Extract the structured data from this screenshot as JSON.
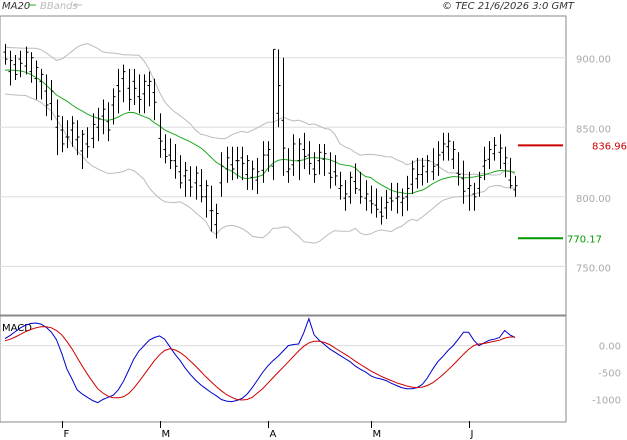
{
  "header": {
    "legend_ma": "MA20",
    "legend_bb": "BBands",
    "copyright": "© TEC 21/6/2026 3:0 GMT"
  },
  "macd_label": "MACD",
  "levels": {
    "resistance": {
      "label": "836.96",
      "value": 836.96,
      "color": "#cc0000"
    },
    "support": {
      "label": "770.17",
      "value": 770.17,
      "color": "#009900"
    }
  },
  "colors": {
    "ma": "#22aa22",
    "bbands": "#bbbbbb",
    "bars": "#000000",
    "macd": "#0000cc",
    "signal": "#cc0000"
  },
  "chart_data": [
    {
      "type": "ohlc",
      "yticks": [
        "900.00",
        "850.00",
        "800.00",
        "750.00"
      ],
      "ytick_values": [
        900,
        850,
        800,
        750
      ],
      "ylim": [
        715,
        930
      ],
      "xticks": [
        "F",
        "M",
        "A",
        "M",
        "J"
      ],
      "xtick_index": [
        11,
        30,
        51,
        71,
        90
      ],
      "ohlc": [
        [
          904,
          910,
          895,
          899
        ],
        [
          890,
          905,
          880,
          898
        ],
        [
          895,
          902,
          884,
          888
        ],
        [
          899,
          905,
          886,
          896
        ],
        [
          894,
          908,
          888,
          904
        ],
        [
          890,
          904,
          882,
          900
        ],
        [
          885,
          898,
          870,
          893
        ],
        [
          883,
          892,
          870,
          888
        ],
        [
          876,
          888,
          858,
          866
        ],
        [
          867,
          884,
          855,
          876
        ],
        [
          850,
          870,
          830,
          858
        ],
        [
          848,
          858,
          832,
          838
        ],
        [
          843,
          855,
          835,
          843
        ],
        [
          848,
          858,
          836,
          853
        ],
        [
          841,
          855,
          830,
          843
        ],
        [
          833,
          848,
          820,
          845
        ],
        [
          838,
          850,
          828,
          836
        ],
        [
          842,
          860,
          835,
          852
        ],
        [
          850,
          864,
          840,
          856
        ],
        [
          858,
          870,
          845,
          863
        ],
        [
          854,
          868,
          840,
          848
        ],
        [
          866,
          878,
          852,
          872
        ],
        [
          880,
          892,
          860,
          876
        ],
        [
          885,
          895,
          868,
          890
        ],
        [
          878,
          892,
          862,
          870
        ],
        [
          883,
          892,
          866,
          878
        ],
        [
          872,
          888,
          860,
          870
        ],
        [
          874,
          888,
          860,
          883
        ],
        [
          880,
          890,
          865,
          883
        ],
        [
          875,
          885,
          855,
          868
        ],
        [
          842,
          860,
          828,
          840
        ],
        [
          834,
          845,
          824,
          829
        ],
        [
          830,
          842,
          820,
          826
        ],
        [
          826,
          838,
          813,
          822
        ],
        [
          818,
          830,
          806,
          810
        ],
        [
          815,
          825,
          800,
          819
        ],
        [
          812,
          822,
          800,
          807
        ],
        [
          810,
          822,
          798,
          817
        ],
        [
          808,
          820,
          796,
          800
        ],
        [
          800,
          812,
          785,
          808
        ],
        [
          790,
          808,
          775,
          790
        ],
        [
          780,
          795,
          770,
          788
        ],
        [
          810,
          832,
          800,
          822
        ],
        [
          820,
          836,
          810,
          828
        ],
        [
          823,
          836,
          812,
          820
        ],
        [
          826,
          836,
          813,
          826
        ],
        [
          828,
          836,
          812,
          824
        ],
        [
          816,
          830,
          805,
          826
        ],
        [
          814,
          826,
          805,
          820
        ],
        [
          812,
          828,
          802,
          818
        ],
        [
          819,
          840,
          810,
          830
        ],
        [
          830,
          840,
          818,
          834
        ],
        [
          822,
          906,
          812,
          906
        ],
        [
          860,
          906,
          850,
          880
        ],
        [
          855,
          900,
          815,
          835
        ],
        [
          818,
          835,
          810,
          820
        ],
        [
          823,
          845,
          815,
          838
        ],
        [
          826,
          842,
          812,
          838
        ],
        [
          834,
          846,
          820,
          829
        ],
        [
          830,
          840,
          816,
          824
        ],
        [
          820,
          832,
          810,
          816
        ],
        [
          826,
          838,
          816,
          832
        ],
        [
          827,
          838,
          815,
          831
        ],
        [
          817,
          832,
          806,
          814
        ],
        [
          818,
          830,
          808,
          815
        ],
        [
          806,
          818,
          798,
          808
        ],
        [
          799,
          812,
          790,
          802
        ],
        [
          800,
          818,
          795,
          814
        ],
        [
          811,
          824,
          802,
          806
        ],
        [
          805,
          818,
          795,
          800
        ],
        [
          799,
          812,
          790,
          802
        ],
        [
          797,
          808,
          788,
          795
        ],
        [
          794,
          806,
          785,
          791
        ],
        [
          789,
          800,
          780,
          786
        ],
        [
          792,
          805,
          784,
          796
        ],
        [
          799,
          810,
          790,
          797
        ],
        [
          799,
          810,
          788,
          800
        ],
        [
          796,
          806,
          786,
          799
        ],
        [
          800,
          815,
          790,
          806
        ],
        [
          809,
          826,
          802,
          820
        ],
        [
          813,
          828,
          806,
          816
        ],
        [
          816,
          828,
          808,
          822
        ],
        [
          818,
          830,
          810,
          826
        ],
        [
          818,
          835,
          812,
          822
        ],
        [
          823,
          840,
          815,
          830
        ],
        [
          832,
          846,
          826,
          838
        ],
        [
          836,
          846,
          826,
          840
        ],
        [
          827,
          840,
          820,
          834
        ],
        [
          817,
          832,
          808,
          816
        ],
        [
          813,
          826,
          795,
          804
        ],
        [
          806,
          818,
          790,
          808
        ],
        [
          802,
          810,
          790,
          800
        ],
        [
          806,
          818,
          800,
          814
        ],
        [
          822,
          836,
          812,
          826
        ],
        [
          827,
          840,
          820,
          834
        ],
        [
          831,
          843,
          826,
          837
        ],
        [
          832,
          845,
          820,
          835
        ],
        [
          824,
          836,
          814,
          828
        ],
        [
          812,
          828,
          806,
          808
        ],
        [
          805,
          815,
          800,
          808
        ]
      ],
      "ma20": [
        891.1,
        891.2,
        890.8,
        890.5,
        889.6,
        887.9,
        885.9,
        883.5,
        880.3,
        876.7,
        873.2,
        871.0,
        868.8,
        866.1,
        863.6,
        861.6,
        859.4,
        857.7,
        856.6,
        855.3,
        855.0,
        855.9,
        857.4,
        859.4,
        860.7,
        860.6,
        859.2,
        857.6,
        856.2,
        853.2,
        851.0,
        848.1,
        846.4,
        844.7,
        842.8,
        841.2,
        839.5,
        837.4,
        835.2,
        832.0,
        828.3,
        824.9,
        822.6,
        820.1,
        818.5,
        815.8,
        813.6,
        813.1,
        813.7,
        814.3,
        815.6,
        820.3,
        824.2,
        826.2,
        826.9,
        826.5,
        825.9,
        825.8,
        826.6,
        828.0,
        828.2,
        827.9,
        827.5,
        826.7,
        825.3,
        823.4,
        822.8,
        822.3,
        820.8,
        817.0,
        814.6,
        813.8,
        811.0,
        808.7,
        806.7,
        804.7,
        803.5,
        802.9,
        802.2,
        802.6,
        803.8,
        804.8,
        806.8,
        809.4,
        811.3,
        812.9,
        813.8,
        814.6,
        814.3,
        813.6,
        813.8,
        814.2,
        815.0,
        815.6,
        816.9,
        818.1,
        818.9,
        818.8,
        818.1,
        817.6
      ],
      "bb_upper": [
        907.5,
        907.3,
        907.1,
        906.9,
        906.8,
        906.8,
        906.8,
        905.8,
        903.3,
        900.8,
        898.1,
        899.1,
        901.7,
        904.6,
        907.6,
        909.2,
        910.1,
        908.5,
        906.7,
        904.2,
        903.6,
        903.4,
        902.8,
        902.2,
        902.0,
        901.9,
        901.8,
        897.6,
        891.8,
        883.2,
        875.3,
        868.3,
        864.3,
        860.9,
        858.3,
        855.5,
        852.3,
        847.9,
        845.1,
        844.2,
        842.9,
        842.3,
        841.8,
        842.1,
        844.6,
        846.0,
        847.1,
        846.2,
        847.8,
        849.6,
        851.7,
        853.6,
        853.7,
        855.3,
        857.3,
        855.7,
        854.5,
        855.1,
        853.8,
        851.9,
        852.4,
        850.9,
        849.2,
        848.7,
        845.0,
        838.3,
        835.9,
        834.4,
        831.8,
        829.9,
        830.4,
        830.5,
        830.1,
        829.6,
        828.8,
        828.7,
        826.7,
        825.2,
        823.1,
        824.1,
        826.4,
        826.3,
        826.1,
        825.1,
        822.1,
        819.7,
        817.4,
        817.1,
        817.2,
        816.2,
        815.9,
        816.3,
        816.1,
        817.0,
        815.8,
        815.6,
        815.9,
        818.6,
        819.0,
        816.1
      ],
      "bb_lower": [
        873.9,
        873.5,
        873.2,
        873.0,
        872.9,
        871.1,
        869.8,
        867.8,
        864.8,
        861.7,
        855.8,
        850.1,
        843.9,
        837.8,
        832.9,
        829.3,
        825.1,
        822.0,
        820.1,
        818.3,
        816.8,
        816.9,
        817.5,
        818.2,
        820.0,
        818.8,
        815.9,
        812.4,
        806.3,
        802.3,
        798.9,
        796.5,
        796.0,
        795.9,
        796.4,
        794.4,
        792.0,
        788.6,
        785.5,
        782.4,
        775.4,
        772.9,
        777.3,
        779.0,
        779.4,
        778.7,
        777.2,
        774.9,
        771.6,
        771.0,
        770.5,
        773.2,
        777.4,
        777.4,
        778.3,
        778.2,
        774.5,
        771.6,
        767.7,
        767.2,
        766.6,
        767.8,
        770.8,
        773.6,
        775.7,
        775.3,
        775.2,
        775.3,
        777.3,
        773.8,
        772.6,
        773.4,
        775.2,
        776.2,
        775.6,
        775.0,
        777.4,
        778.7,
        781.8,
        783.9,
        782.8,
        785.5,
        788.4,
        791.5,
        794.6,
        797.5,
        798.6,
        799.8,
        800.1,
        800.3,
        800.8,
        801.6,
        803.1,
        803.8,
        807.2,
        808.0,
        808.1,
        806.7,
        806.5,
        806.1
      ]
    },
    {
      "type": "line",
      "title": "MACD",
      "yticks": [
        "0.00",
        "-500",
        "-1000"
      ],
      "ytick_values": [
        0,
        -500,
        -1000
      ],
      "ylim": [
        -1400,
        550
      ],
      "series": [
        {
          "values": [
            130,
            190,
            260,
            330,
            380,
            410,
            420,
            400,
            340,
            250,
            110,
            -140,
            -430,
            -620,
            -820,
            -900,
            -960,
            -1020,
            -1060,
            -1000,
            -960,
            -920,
            -820,
            -660,
            -460,
            -250,
            -100,
            0,
            100,
            150,
            180,
            120,
            -20,
            -160,
            -280,
            -420,
            -540,
            -640,
            -730,
            -800,
            -870,
            -930,
            -1000,
            -1030,
            -1040,
            -1020,
            -980,
            -900,
            -780,
            -640,
            -500,
            -380,
            -280,
            -200,
            -100,
            0,
            20,
            30,
            240,
            500,
            200,
            100,
            20,
            -60,
            -120,
            -180,
            -240,
            -300,
            -380,
            -440,
            -490,
            -560,
            -600,
            -620,
            -650,
            -700,
            -740,
            -780,
            -800,
            -800,
            -780,
            -720,
            -600,
            -440,
            -300,
            -200,
            -90,
            0,
            120,
            250,
            250,
            100,
            0,
            50,
            100,
            120,
            150,
            280,
            200,
            150
          ]
        },
        {
          "values": [
            90,
            120,
            160,
            210,
            260,
            300,
            330,
            350,
            350,
            330,
            280,
            200,
            80,
            -60,
            -220,
            -380,
            -530,
            -670,
            -800,
            -880,
            -940,
            -970,
            -970,
            -950,
            -890,
            -790,
            -670,
            -540,
            -410,
            -280,
            -170,
            -90,
            -60,
            -80,
            -130,
            -200,
            -290,
            -380,
            -480,
            -580,
            -670,
            -760,
            -840,
            -910,
            -960,
            -1000,
            -1010,
            -1000,
            -960,
            -880,
            -800,
            -700,
            -600,
            -500,
            -400,
            -300,
            -200,
            -100,
            -10,
            50,
            80,
            80,
            60,
            20,
            -40,
            -100,
            -160,
            -220,
            -290,
            -350,
            -410,
            -470,
            -520,
            -570,
            -610,
            -650,
            -690,
            -720,
            -750,
            -770,
            -780,
            -770,
            -740,
            -690,
            -620,
            -540,
            -450,
            -360,
            -260,
            -160,
            -70,
            0,
            30,
            40,
            60,
            80,
            100,
            140,
            160,
            160
          ]
        }
      ]
    }
  ]
}
